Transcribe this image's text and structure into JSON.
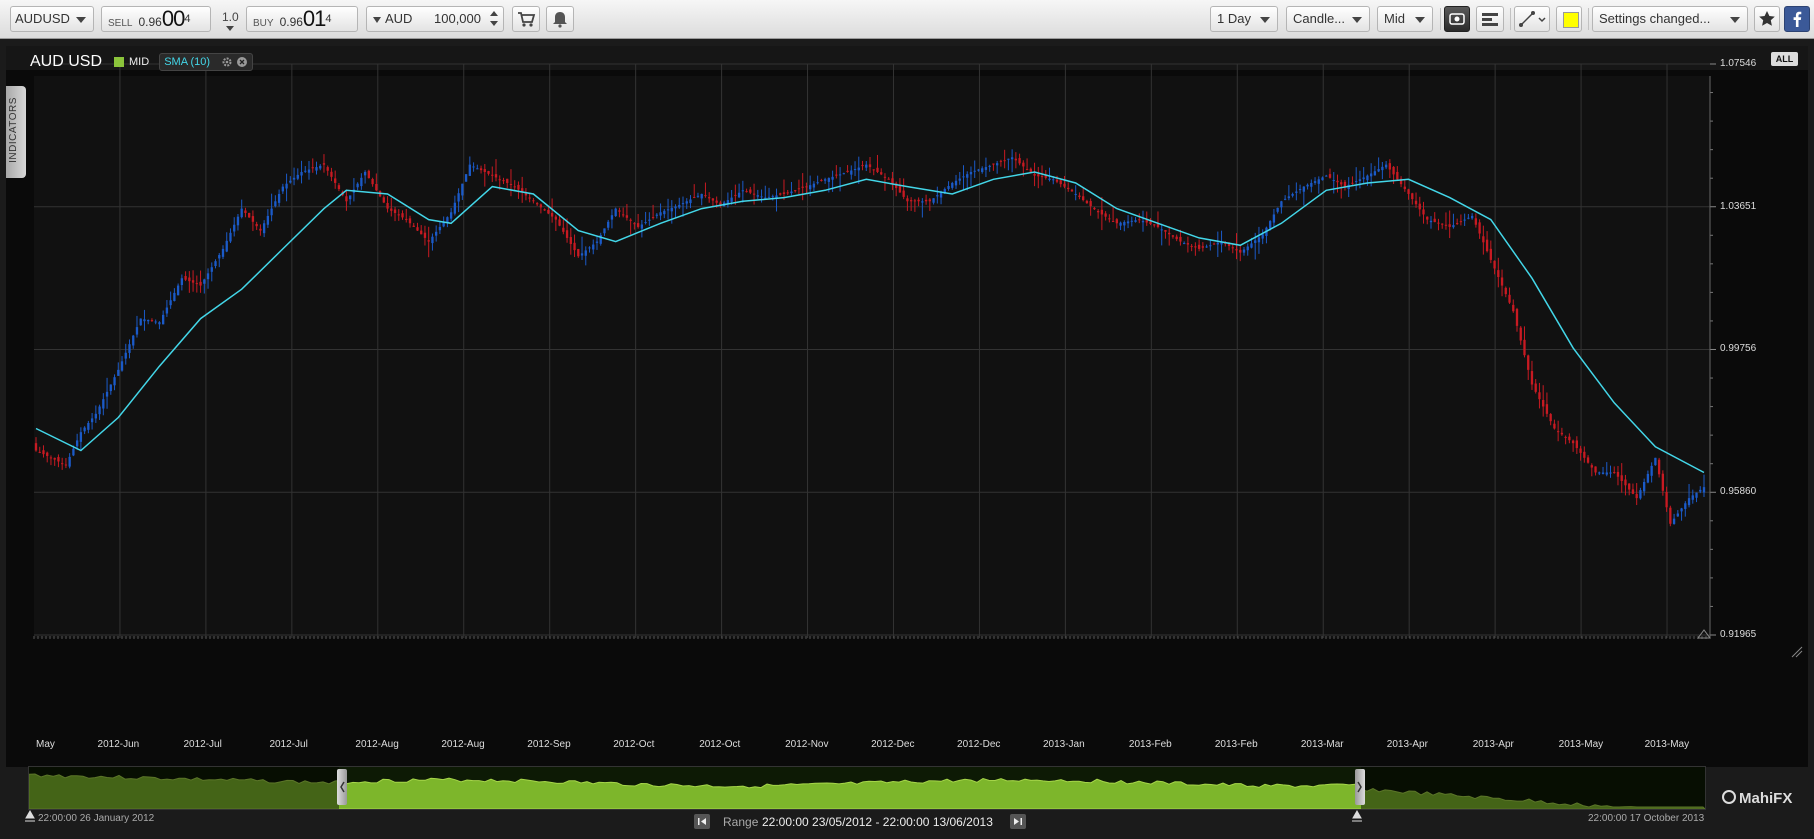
{
  "toolbar": {
    "symbol": "AUDUSD",
    "sell_label": "SELL",
    "sell_price_small": "0.96",
    "sell_price_big": "00",
    "sell_price_sup": "4",
    "spread": "1.0",
    "buy_label": "BUY",
    "buy_price_small": "0.96",
    "buy_price_big": "01",
    "buy_price_sup": "4",
    "currency": "AUD",
    "quantity": "100,000",
    "timeframe": "1 Day",
    "chart_type": "Candle...",
    "price_type": "Mid",
    "settings": "Settings changed...",
    "highlight_color": "#ffff00"
  },
  "legend": {
    "pair": "AUD USD",
    "mid_label": "MID",
    "sma_label": "SMA (10)",
    "indicators_tab": "INDICATORS",
    "all_button": "ALL"
  },
  "footer": {
    "range_label": "Range",
    "range_value": "22:00:00 23/05/2012 - 22:00:00 13/06/2013",
    "start_date": "22:00:00 26 January 2012",
    "end_date": "22:00:00 17 October 2013",
    "logo": "MahiFX"
  },
  "colors": {
    "up_candle": "#1b5ac8",
    "down_candle": "#c81a22",
    "sma_line": "#43d6e8",
    "mid_square": "#8bc43b",
    "nav_fill": "#7db62b"
  },
  "chart_data": {
    "type": "candlestick",
    "symbol": "AUD USD",
    "price_type": "MID",
    "ylim": [
      0.91965,
      1.07546
    ],
    "y_ticks": [
      "1.07546",
      "1.03651",
      "0.99756",
      "0.95860",
      "0.91965"
    ],
    "x_tick_labels": [
      "May",
      "2012-Jun",
      "2012-Jul",
      "2012-Jul",
      "2012-Aug",
      "2012-Aug",
      "2012-Sep",
      "2012-Oct",
      "2012-Oct",
      "2012-Nov",
      "2012-Dec",
      "2012-Dec",
      "2013-Jan",
      "2013-Feb",
      "2013-Feb",
      "2013-Mar",
      "2013-Apr",
      "2013-Apr",
      "2013-May",
      "2013-May"
    ],
    "grid": true,
    "close_path": [
      [
        0,
        0.97
      ],
      [
        8,
        0.966
      ],
      [
        12,
        0.975
      ],
      [
        16,
        0.98
      ],
      [
        22,
        0.992
      ],
      [
        28,
        1.006
      ],
      [
        33,
        1.005
      ],
      [
        39,
        1.017
      ],
      [
        44,
        1.015
      ],
      [
        50,
        1.025
      ],
      [
        55,
        1.036
      ],
      [
        60,
        1.03
      ],
      [
        66,
        1.042
      ],
      [
        71,
        1.046
      ],
      [
        77,
        1.048
      ],
      [
        83,
        1.038
      ],
      [
        88,
        1.046
      ],
      [
        94,
        1.036
      ],
      [
        99,
        1.033
      ],
      [
        105,
        1.027
      ],
      [
        111,
        1.035
      ],
      [
        116,
        1.048
      ],
      [
        122,
        1.045
      ],
      [
        128,
        1.042
      ],
      [
        133,
        1.038
      ],
      [
        139,
        1.033
      ],
      [
        145,
        1.023
      ],
      [
        150,
        1.027
      ],
      [
        155,
        1.036
      ],
      [
        161,
        1.031
      ],
      [
        167,
        1.035
      ],
      [
        172,
        1.037
      ],
      [
        178,
        1.04
      ],
      [
        183,
        1.037
      ],
      [
        189,
        1.041
      ],
      [
        195,
        1.039
      ],
      [
        200,
        1.04
      ],
      [
        206,
        1.042
      ],
      [
        211,
        1.044
      ],
      [
        217,
        1.046
      ],
      [
        222,
        1.048
      ],
      [
        228,
        1.044
      ],
      [
        233,
        1.038
      ],
      [
        239,
        1.038
      ],
      [
        245,
        1.043
      ],
      [
        250,
        1.046
      ],
      [
        256,
        1.048
      ],
      [
        261,
        1.05
      ],
      [
        267,
        1.045
      ],
      [
        272,
        1.044
      ],
      [
        278,
        1.04
      ],
      [
        284,
        1.035
      ],
      [
        289,
        1.032
      ],
      [
        295,
        1.033
      ],
      [
        300,
        1.031
      ],
      [
        306,
        1.027
      ],
      [
        311,
        1.025
      ],
      [
        317,
        1.027
      ],
      [
        322,
        1.024
      ],
      [
        328,
        1.029
      ],
      [
        333,
        1.038
      ],
      [
        339,
        1.042
      ],
      [
        345,
        1.045
      ],
      [
        350,
        1.042
      ],
      [
        356,
        1.045
      ],
      [
        361,
        1.048
      ],
      [
        367,
        1.04
      ],
      [
        372,
        1.033
      ],
      [
        378,
        1.031
      ],
      [
        384,
        1.034
      ],
      [
        389,
        1.022
      ],
      [
        395,
        1.008
      ],
      [
        400,
        0.988
      ],
      [
        406,
        0.976
      ],
      [
        411,
        0.972
      ],
      [
        417,
        0.964
      ],
      [
        422,
        0.964
      ],
      [
        428,
        0.957
      ],
      [
        433,
        0.968
      ],
      [
        437,
        0.95
      ],
      [
        442,
        0.957
      ],
      [
        446,
        0.96
      ]
    ],
    "sma_period": 10,
    "sma_path": [
      [
        0,
        0.976
      ],
      [
        12,
        0.97
      ],
      [
        22,
        0.979
      ],
      [
        33,
        0.993
      ],
      [
        44,
        1.006
      ],
      [
        55,
        1.014
      ],
      [
        66,
        1.025
      ],
      [
        77,
        1.036
      ],
      [
        83,
        1.041
      ],
      [
        94,
        1.04
      ],
      [
        105,
        1.033
      ],
      [
        111,
        1.032
      ],
      [
        122,
        1.042
      ],
      [
        133,
        1.04
      ],
      [
        145,
        1.03
      ],
      [
        155,
        1.027
      ],
      [
        167,
        1.032
      ],
      [
        178,
        1.036
      ],
      [
        189,
        1.038
      ],
      [
        200,
        1.039
      ],
      [
        211,
        1.041
      ],
      [
        222,
        1.044
      ],
      [
        233,
        1.042
      ],
      [
        245,
        1.04
      ],
      [
        256,
        1.044
      ],
      [
        267,
        1.046
      ],
      [
        278,
        1.043
      ],
      [
        289,
        1.036
      ],
      [
        300,
        1.032
      ],
      [
        311,
        1.028
      ],
      [
        322,
        1.026
      ],
      [
        333,
        1.032
      ],
      [
        345,
        1.041
      ],
      [
        356,
        1.043
      ],
      [
        367,
        1.044
      ],
      [
        378,
        1.039
      ],
      [
        389,
        1.033
      ],
      [
        400,
        1.017
      ],
      [
        411,
        0.998
      ],
      [
        422,
        0.983
      ],
      [
        433,
        0.971
      ],
      [
        446,
        0.964
      ]
    ]
  }
}
